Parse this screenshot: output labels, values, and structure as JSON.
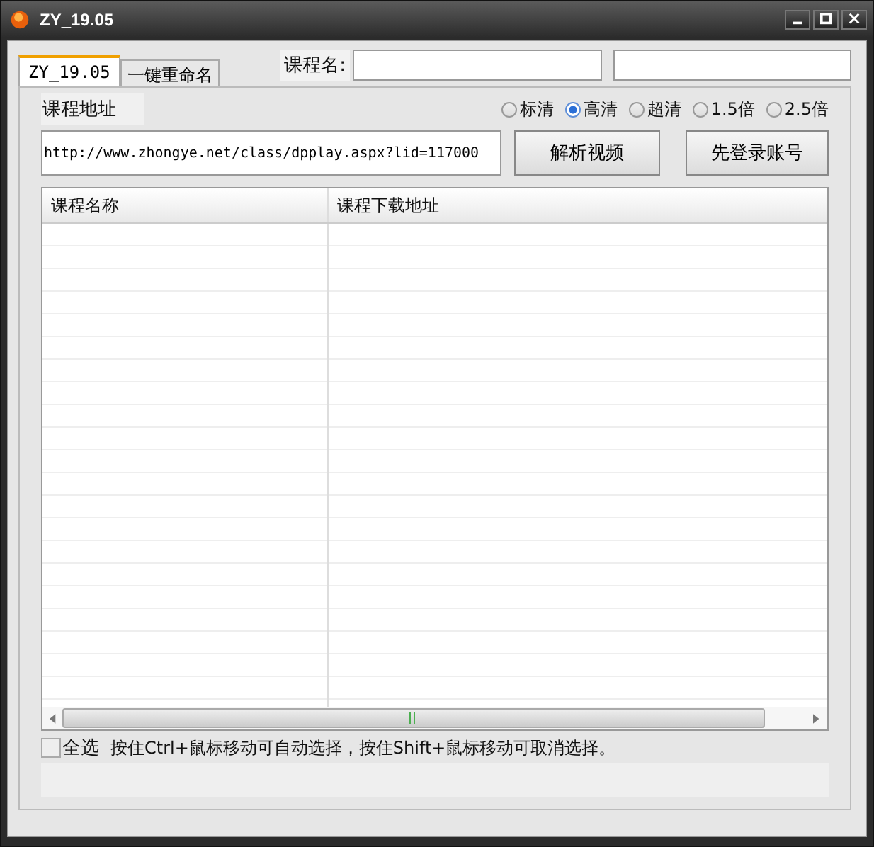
{
  "window": {
    "title": "ZY_19.05"
  },
  "tabs": [
    {
      "label": "ZY_19.05",
      "selected": true
    },
    {
      "label": "一键重命名",
      "selected": false
    }
  ],
  "course_name": {
    "label": "课程名:"
  },
  "address": {
    "label": "课程地址",
    "value": "http://www.zhongye.net/class/dpplay.aspx?lid=117000"
  },
  "quality_options": [
    {
      "label": "标清",
      "selected": false
    },
    {
      "label": "高清",
      "selected": true
    },
    {
      "label": "超清",
      "selected": false
    },
    {
      "label": "1.5倍",
      "selected": false
    },
    {
      "label": "2.5倍",
      "selected": false
    }
  ],
  "buttons": [
    "解析视频",
    "先登录账号"
  ],
  "table": {
    "columns": [
      "课程名称",
      "课程下载地址"
    ]
  },
  "select_all": {
    "label": "全选",
    "checked": false
  },
  "hint": "按住Ctrl+鼠标移动可自动选择，按住Shift+鼠标移动可取消选择。"
}
